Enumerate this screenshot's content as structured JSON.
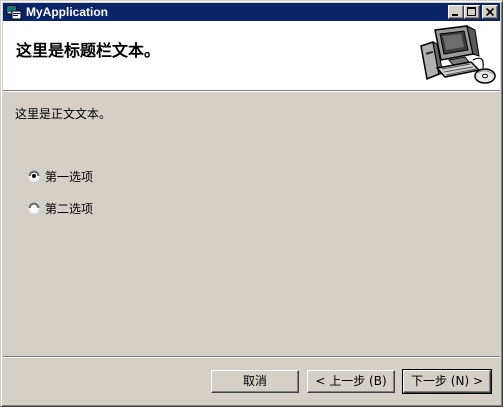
{
  "window": {
    "title": "MyApplication"
  },
  "header": {
    "title": "这里是标题栏文本。",
    "graphic": "computer-illustration"
  },
  "body": {
    "text": "这里是正文文本。",
    "options": [
      {
        "label": "第一选项",
        "selected": true
      },
      {
        "label": "第二选项",
        "selected": false
      }
    ]
  },
  "buttons": {
    "cancel": "取消",
    "back": "< 上一步 (B)",
    "next": "下一步 (N) >"
  },
  "colors": {
    "titlebar": "#0a246a",
    "face": "#d4d0c8",
    "header_bg": "#ffffff"
  }
}
